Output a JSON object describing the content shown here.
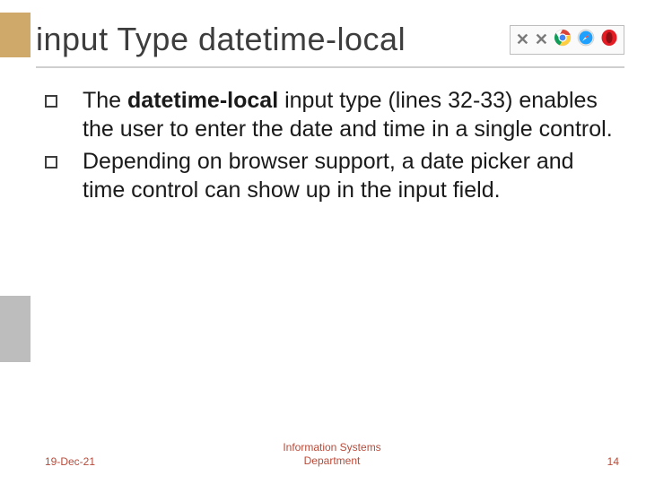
{
  "title": "input Type datetime-local",
  "browser_support": {
    "unsupported_count": 2,
    "icons": [
      "chrome-icon",
      "safari-icon",
      "opera-icon"
    ]
  },
  "bullets": [
    {
      "segments": [
        {
          "text": "The ",
          "bold": false
        },
        {
          "text": "datetime-local",
          "bold": true
        },
        {
          "text": " input type (lines 32-33) enables the user to enter the date and time in a single control.",
          "bold": false
        }
      ]
    },
    {
      "segments": [
        {
          "text": "Depending on browser support, a date picker and time control can show up in the input field.",
          "bold": false
        }
      ]
    }
  ],
  "footer": {
    "date": "19-Dec-21",
    "center_line1": "Information Systems",
    "center_line2": "Department",
    "page": "14"
  }
}
